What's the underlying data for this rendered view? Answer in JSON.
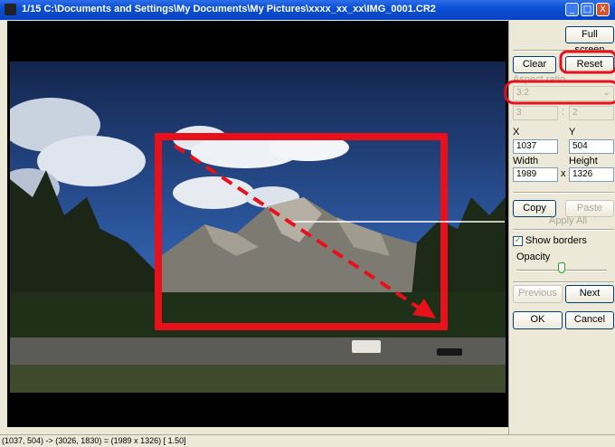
{
  "window": {
    "title": "1/15  C:\\Documents and Settings\\My Documents\\My Pictures\\xxxx_xx_xx\\IMG_0001.CR2",
    "minimize_label": "_",
    "maximize_label": "□",
    "close_label": "X"
  },
  "toolbar": {
    "full_screen_label": "Full screen",
    "clear_label": "Clear",
    "reset_label": "Reset"
  },
  "aspect_ratio": {
    "label": "Aspect ratio",
    "value": "3:2",
    "width_value": "3",
    "separator": ":",
    "height_value": "2"
  },
  "crop": {
    "x_label": "X",
    "x_value": "1037",
    "y_label": "Y",
    "y_value": "504",
    "width_label": "Width",
    "width_value": "1989",
    "times": "x",
    "height_label": "Height",
    "height_value": "1326"
  },
  "actions": {
    "copy_label": "Copy",
    "paste_label": "Paste",
    "apply_all_label": "Apply All"
  },
  "display": {
    "show_borders_label": "Show borders",
    "show_borders_checked": true,
    "opacity_label": "Opacity",
    "opacity_level": 0.5
  },
  "navigation": {
    "previous_label": "Previous",
    "next_label": "Next",
    "ok_label": "OK",
    "cancel_label": "Cancel"
  },
  "status": {
    "text": "(1037,  504) -> (3026, 1830) = (1989 x 1326) [ 1.50]"
  },
  "colors": {
    "highlight": "#e8101a",
    "titlebar": "#0a4fd6"
  }
}
